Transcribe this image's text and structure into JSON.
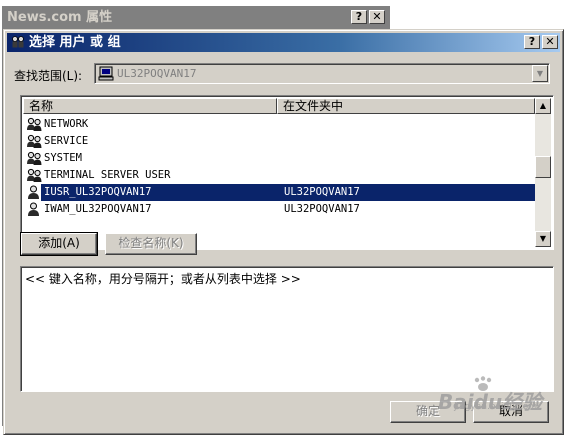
{
  "background_window": {
    "title": "News.com 属性",
    "help_btn": "?",
    "close_btn": "✕"
  },
  "dialog": {
    "title": "选择 用户 或 组",
    "help_btn": "?",
    "close_btn": "✕",
    "look_in": {
      "label": "查找范围(L):",
      "value": "UL32POQVAN17"
    },
    "list": {
      "columns": [
        "名称",
        "在文件夹中"
      ],
      "rows": [
        {
          "name": "NETWORK",
          "folder": "",
          "icon": "group-icon",
          "selected": false
        },
        {
          "name": "SERVICE",
          "folder": "",
          "icon": "group-icon",
          "selected": false
        },
        {
          "name": "SYSTEM",
          "folder": "",
          "icon": "group-icon",
          "selected": false
        },
        {
          "name": "TERMINAL SERVER USER",
          "folder": "",
          "icon": "group-icon",
          "selected": false
        },
        {
          "name": "IUSR_UL32POQVAN17",
          "folder": "UL32POQVAN17",
          "icon": "user-icon",
          "selected": true
        },
        {
          "name": "IWAM_UL32POQVAN17",
          "folder": "UL32POQVAN17",
          "icon": "user-icon",
          "selected": false
        }
      ]
    },
    "add_btn": "添加(A)",
    "check_names_btn": "检查名称(K)",
    "names_text": "<< 键入名称，用分号隔开；或者从列表中选择 >>",
    "ok_btn": "确定",
    "cancel_btn": "取消"
  },
  "watermark": {
    "text": "Baidu经验",
    "sub": "jingyan.baidu.com"
  }
}
